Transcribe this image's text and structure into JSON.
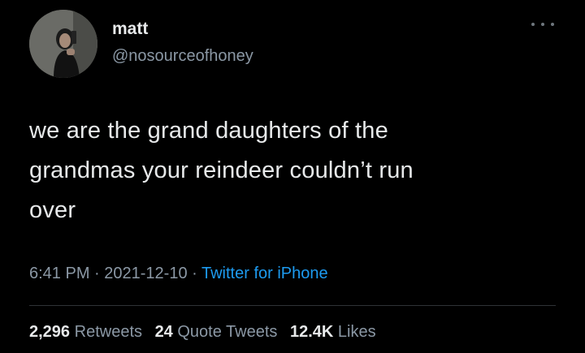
{
  "author": {
    "display_name": "matt",
    "handle": "@nosourceofhoney"
  },
  "tweet": {
    "lines": [
      "we are the grand daughters of the",
      "grandmas your reindeer couldn’t run",
      "over"
    ]
  },
  "meta": {
    "time": "6:41 PM",
    "separator": " · ",
    "date": "2021-12-10",
    "source": "Twitter for iPhone"
  },
  "stats": {
    "retweets_count": "2,296",
    "retweets_label": "Retweets",
    "quotes_count": "24",
    "quotes_label": "Quote Tweets",
    "likes_count": "12.4K",
    "likes_label": "Likes"
  },
  "icons": {
    "more": "more-options-icon",
    "avatar": "avatar"
  },
  "colors": {
    "background": "#000000",
    "text": "#e7e9ea",
    "secondary": "#8b98a5",
    "link": "#1d9bf0",
    "divider": "#2f3336"
  }
}
